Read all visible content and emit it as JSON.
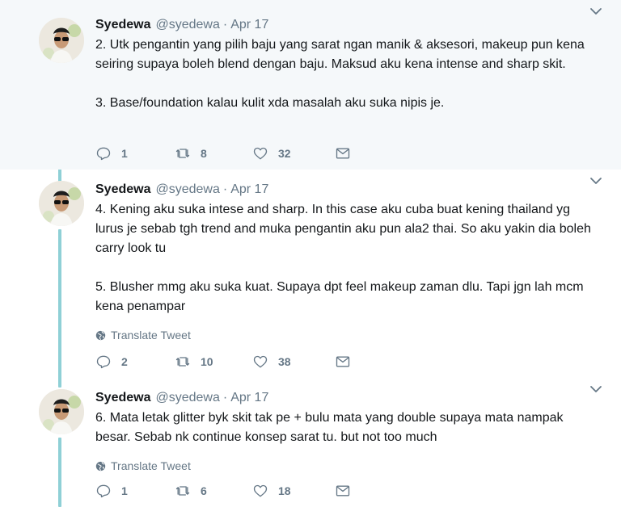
{
  "tweets": [
    {
      "author": "Syedewa",
      "handle": "@syedewa",
      "separator": "·",
      "date": "Apr 17",
      "text": "2. Utk pengantin yang pilih baju yang sarat ngan manik & aksesori, makeup pun kena seiring supaya boleh blend dengan baju. Maksud aku kena intense and sharp skit.\n\n3. Base/foundation kalau kulit xda masalah aku suka nipis je.",
      "translate_label": "",
      "replies": "1",
      "retweets": "8",
      "likes": "32"
    },
    {
      "author": "Syedewa",
      "handle": "@syedewa",
      "separator": "·",
      "date": "Apr 17",
      "text": "4. Kening aku suka intese and sharp. In this case aku cuba buat kening thailand yg lurus je sebab tgh trend and muka pengantin aku pun ala2 thai. So aku yakin dia boleh carry look tu\n\n5. Blusher mmg aku suka kuat. Supaya dpt feel makeup zaman dlu. Tapi jgn lah mcm kena penampar",
      "translate_label": "Translate Tweet",
      "replies": "2",
      "retweets": "10",
      "likes": "38"
    },
    {
      "author": "Syedewa",
      "handle": "@syedewa",
      "separator": "·",
      "date": "Apr 17",
      "text": "6. Mata letak glitter byk skit tak pe + bulu mata yang double supaya mata nampak besar. Sebab nk continue konsep sarat tu. but not too much",
      "translate_label": "Translate Tweet",
      "replies": "1",
      "retweets": "6",
      "likes": "18"
    }
  ],
  "colors": {
    "thread_line": "#8fd0d6",
    "highlight_bg": "#f5f8fa",
    "muted": "#657786",
    "text": "#14171a"
  },
  "icons": [
    "reply-icon",
    "retweet-icon",
    "like-icon",
    "message-icon",
    "chevron-down-icon",
    "globe-icon"
  ]
}
